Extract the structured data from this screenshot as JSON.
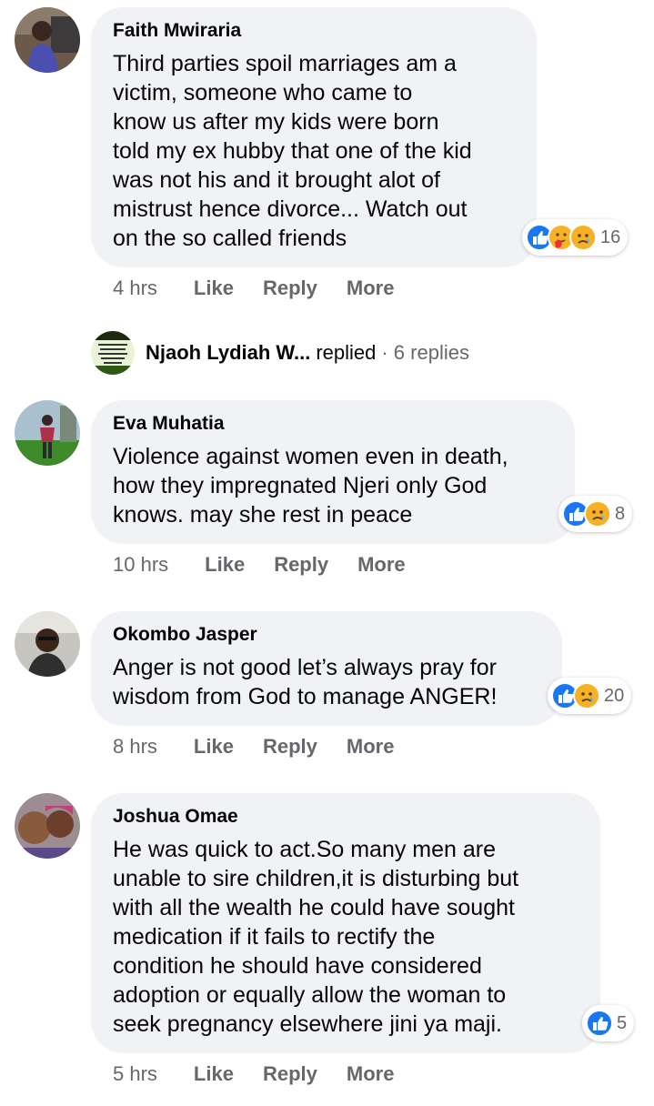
{
  "comments": [
    {
      "author": "Faith Mwiraria",
      "text": "Third parties spoil marriages am a\nvictim, someone who came to\nknow us after my kids were born\ntold my ex hubby that one of the kid\nwas not his and it brought alot of\nmistrust hence divorce... Watch out\non the so called friends",
      "time": "4 hrs",
      "like": "Like",
      "reply": "Reply",
      "more": "More",
      "reactions": [
        "like-icon",
        "care-icon",
        "sad-icon"
      ],
      "reaction_count": "16"
    },
    {
      "author": "Eva Muhatia",
      "text": "Violence against women even in death,\nhow they impregnated Njeri only God\nknows. may she rest in peace",
      "time": "10 hrs",
      "like": "Like",
      "reply": "Reply",
      "more": "More",
      "reactions": [
        "like-icon",
        "sad-icon"
      ],
      "reaction_count": "8"
    },
    {
      "author": "Okombo Jasper",
      "text": "Anger is not good let’s always pray for\nwisdom from God to manage ANGER!",
      "time": "8 hrs",
      "like": "Like",
      "reply": "Reply",
      "more": "More",
      "reactions": [
        "like-icon",
        "sad-icon"
      ],
      "reaction_count": "20"
    },
    {
      "author": "Joshua Omae",
      "text": "He was quick to act.So many men are\nunable to sire children,it is disturbing but\nwith all the wealth he could have sought\nmedication if it fails to rectify the\ncondition he should have considered\nadoption or equally allow the woman to\nseek pregnancy elsewhere jini ya maji.",
      "time": "5 hrs",
      "like": "Like",
      "reply": "Reply",
      "more": "More",
      "reactions": [
        "like-icon"
      ],
      "reaction_count": "5"
    }
  ],
  "replies": {
    "name": "Njaoh Lydiah W...",
    "action": "replied",
    "count": "· 6 replies"
  },
  "colors": {
    "bubble": "#f0f2f5",
    "secondary_text": "#65676b",
    "like_blue": "#1877f2",
    "sad_yellow": "#f7b125"
  }
}
